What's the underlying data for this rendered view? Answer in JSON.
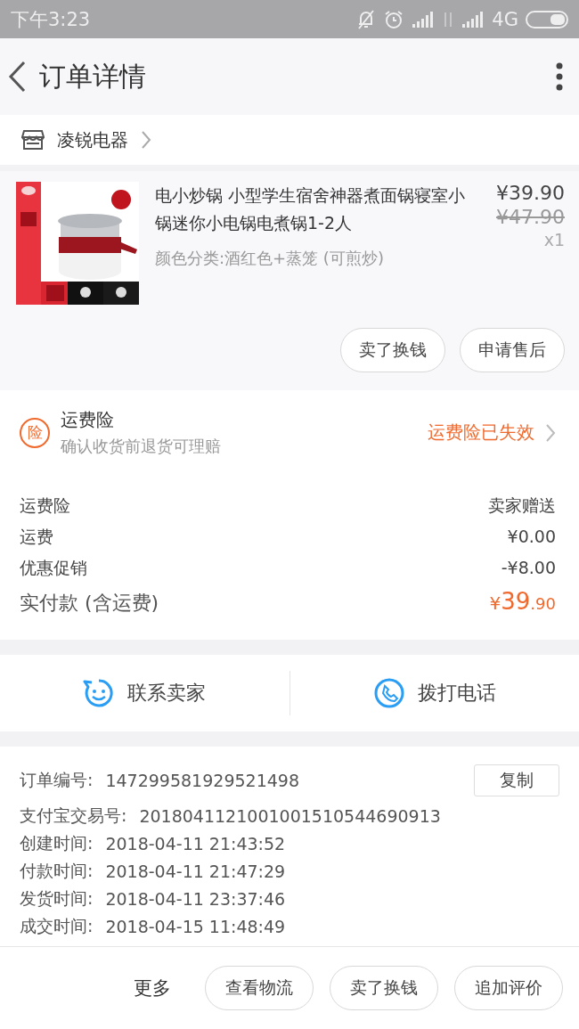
{
  "status_bar": {
    "time": "下午3:23",
    "network": "4G"
  },
  "header": {
    "title": "订单详情"
  },
  "shop": {
    "name": "凌锐电器"
  },
  "product": {
    "title": "电小炒锅 小型学生宿舍神器煮面锅寝室小锅迷你小电锅电煮锅1-2人",
    "variant": "颜色分类:酒红色+蒸笼 (可煎炒)",
    "price": "¥39.90",
    "original_price": "¥47.90",
    "quantity": "x1",
    "buttons": [
      "卖了换钱",
      "申请售后"
    ]
  },
  "insurance": {
    "badge": "险",
    "title": "运费险",
    "subtitle": "确认收货前退货可理赔",
    "status": "运费险已失效"
  },
  "costs": [
    {
      "label": "运费险",
      "value": "卖家赠送",
      "kind": "normal"
    },
    {
      "label": "运费",
      "value": "¥0.00",
      "kind": "normal"
    },
    {
      "label": "优惠促销",
      "value": "-¥8.00",
      "kind": "normal"
    },
    {
      "label": "实付款 (含运费)",
      "value": "¥39.90",
      "kind": "total"
    }
  ],
  "contact": [
    {
      "label": "联系卖家",
      "kind": "chat"
    },
    {
      "label": "拨打电话",
      "kind": "phone"
    }
  ],
  "order_info": {
    "copy_button": "复制",
    "rows": [
      {
        "label": "订单编号:",
        "value": "147299581929521498"
      },
      {
        "label": "支付宝交易号:",
        "value": "2018041121001001510544690913"
      },
      {
        "label": "创建时间:",
        "value": "2018-04-11 21:43:52"
      },
      {
        "label": "付款时间:",
        "value": "2018-04-11 21:47:29"
      },
      {
        "label": "发货时间:",
        "value": "2018-04-11 23:37:46"
      },
      {
        "label": "成交时间:",
        "value": "2018-04-15 11:48:49"
      }
    ]
  },
  "bottom_bar": {
    "more": "更多",
    "buttons": [
      "查看物流",
      "卖了换钱",
      "追加评价"
    ]
  }
}
